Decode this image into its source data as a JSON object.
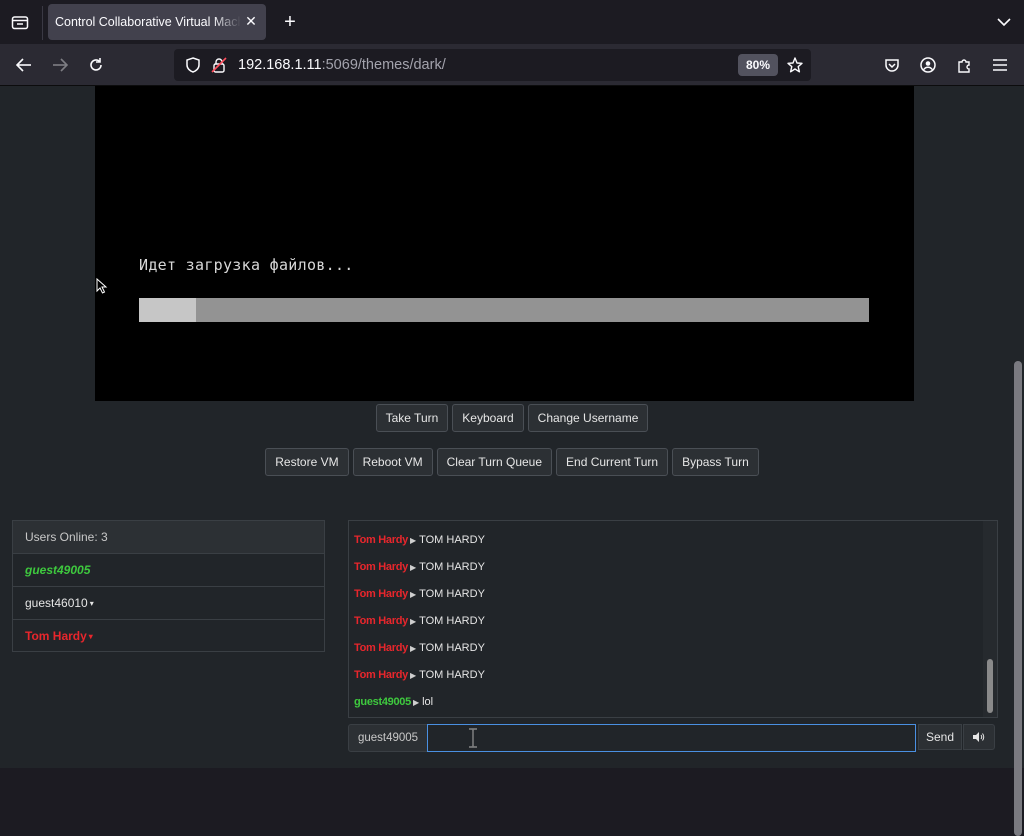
{
  "browser": {
    "tab_title": "Control Collaborative Virtual Machine",
    "url_host": "192.168.1.11",
    "url_rest": ":5069/themes/dark/",
    "zoom": "80%"
  },
  "vm": {
    "status_text": "Идет загрузка файлов...",
    "progress": 0.078
  },
  "controls": {
    "row1": [
      "Take Turn",
      "Keyboard",
      "Change Username"
    ],
    "row2": [
      "Restore VM",
      "Reboot VM",
      "Clear Turn Queue",
      "End Current Turn",
      "Bypass Turn"
    ]
  },
  "users": {
    "header": "Users Online: 3",
    "list": [
      {
        "name": "guest49005",
        "type": "self",
        "caret": ""
      },
      {
        "name": "guest46010",
        "type": "normal",
        "caret": "▾"
      },
      {
        "name": "Tom Hardy",
        "type": "admin",
        "caret": "▾"
      }
    ]
  },
  "chat": {
    "messages": [
      {
        "user": "Tom Hardy",
        "text": "TOM HARDY",
        "type": "admin"
      },
      {
        "user": "Tom Hardy",
        "text": "TOM HARDY",
        "type": "admin"
      },
      {
        "user": "Tom Hardy",
        "text": "TOM HARDY",
        "type": "admin"
      },
      {
        "user": "Tom Hardy",
        "text": "TOM HARDY",
        "type": "admin"
      },
      {
        "user": "Tom Hardy",
        "text": "TOM HARDY",
        "type": "admin"
      },
      {
        "user": "Tom Hardy",
        "text": "TOM HARDY",
        "type": "admin"
      },
      {
        "user": "guest49005",
        "text": "lol",
        "type": "self"
      }
    ],
    "username_label": "guest49005",
    "input_value": "",
    "send_label": "Send"
  },
  "colors": {
    "admin": "#e8262c",
    "self": "#3ec93e",
    "focus": "#4a90e2"
  }
}
